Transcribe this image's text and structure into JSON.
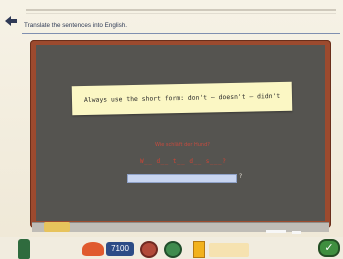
{
  "header": {
    "instruction": "Translate the sentences into English."
  },
  "note": {
    "text": "Always use the short form: don't – doesn't – didn't"
  },
  "exercise": {
    "prompt": "Wie schläft der Hund?",
    "pattern": "W__ d__ t__ d__ s___?",
    "answer_value": "",
    "trailing_mark": "?"
  },
  "toolbar": {
    "score": "7100"
  },
  "icons": {
    "back": "back-arrow-icon",
    "ok": "checkmark-icon"
  },
  "colors": {
    "board": "#555450",
    "frame": "#9c4a2e",
    "note": "#fbf7c4",
    "prompt": "#c54b3f"
  }
}
